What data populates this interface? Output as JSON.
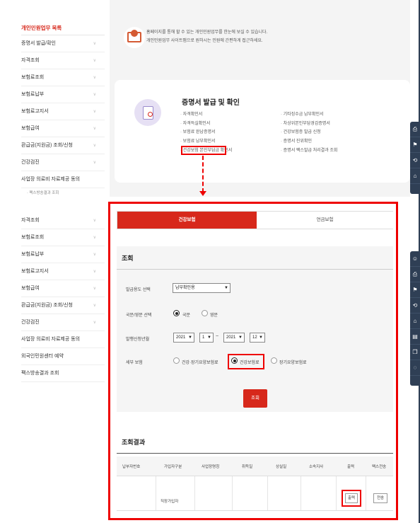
{
  "sidebar": {
    "title": "개인민원업무 목록",
    "items": [
      {
        "label": "증명서 발급/확인",
        "chev": "∨"
      },
      {
        "label": "자격조회",
        "chev": "∨"
      },
      {
        "label": "보험료조회",
        "chev": "∨"
      },
      {
        "label": "보험료납부",
        "chev": "∨"
      },
      {
        "label": "보험료고지서",
        "chev": "∨"
      },
      {
        "label": "보험급여",
        "chev": "∨"
      },
      {
        "label": "환급금(지원금) 조회/신청",
        "chev": "∨"
      },
      {
        "label": "건강검진",
        "chev": "∨"
      },
      {
        "label": "사업장 의료비 자료제공 동의",
        "chev": ""
      }
    ],
    "sub_item": "· 팩스방송결과 조회",
    "items2": [
      {
        "label": "자격조회",
        "chev": "∨"
      },
      {
        "label": "보험료조회",
        "chev": "∨"
      },
      {
        "label": "보험료납부",
        "chev": "∨"
      },
      {
        "label": "보험료고지서",
        "chev": "∨"
      },
      {
        "label": "보험급여",
        "chev": "∨"
      },
      {
        "label": "환급금(지원금) 조회/신청",
        "chev": "∨"
      },
      {
        "label": "건강검진",
        "chev": "∨"
      },
      {
        "label": "사업장 의료비 자료제공 동의",
        "chev": ""
      },
      {
        "label": "외국인민원센터 예약",
        "chev": ""
      },
      {
        "label": "팩스방송결과 조회",
        "chev": ""
      }
    ]
  },
  "notice": {
    "line1": "홈페이지를 통해 할 수 있는 개인민원업무를 한눈에 보실 수 있습니다.",
    "line2": "개인민원업무 사이트맵으로 원하시는 민원에 간편하게 접근하세요."
  },
  "cert": {
    "title": "증명서 발급 및 확인",
    "col1": [
      "자격확인서",
      "자격득실확인서",
      "보험료 완납증명서",
      "보험료 납부확인서",
      "건강보험 본인부담금 확인서"
    ],
    "col2": [
      "기타징수금 납부확인서",
      "차상위본인부담경감증명서",
      "건강보험증 발급 신청",
      "증명서 진위확인",
      "증명서 팩스발급 처리결과 조회"
    ]
  },
  "tabs": {
    "active": "건강보험",
    "inactive": "연금보험"
  },
  "query": {
    "title": "조회",
    "purpose_label": "발급용도 선택",
    "purpose_value": "납부확인용",
    "lang_label": "국문/영문 선택",
    "lang_kr": "국문",
    "lang_en": "영문",
    "period_label": "발행신청년월",
    "from_year": "2021",
    "from_month": "1",
    "to_year": "2021",
    "to_month": "12",
    "range_sep": "~",
    "detail_label": "세부 보험",
    "opt1": "건강·장기요양보험료",
    "opt2": "건강보험료",
    "opt3": "장기요양보험료",
    "search_btn": "조회"
  },
  "result": {
    "title": "조회결과",
    "headers": [
      "납부자번호",
      "가입자구분",
      "사업장명칭",
      "취득일",
      "상실일",
      "소속지사",
      "출력",
      "팩스전송"
    ],
    "row_type": "직장가입자",
    "print_btn": "출력",
    "send_btn": "전송"
  },
  "icons_top": [
    "printer-icon",
    "bookmark-icon",
    "share-icon",
    "home-icon"
  ],
  "icons_bottom": [
    "user-icon",
    "printer-icon",
    "bookmark-icon",
    "share-icon",
    "home-icon",
    "document-icon",
    "copy-icon",
    "chat-icon"
  ],
  "colors": {
    "brand_red": "#d7281b",
    "highlight_red": "#ee0000",
    "icon_bar": "#2f3f55"
  }
}
